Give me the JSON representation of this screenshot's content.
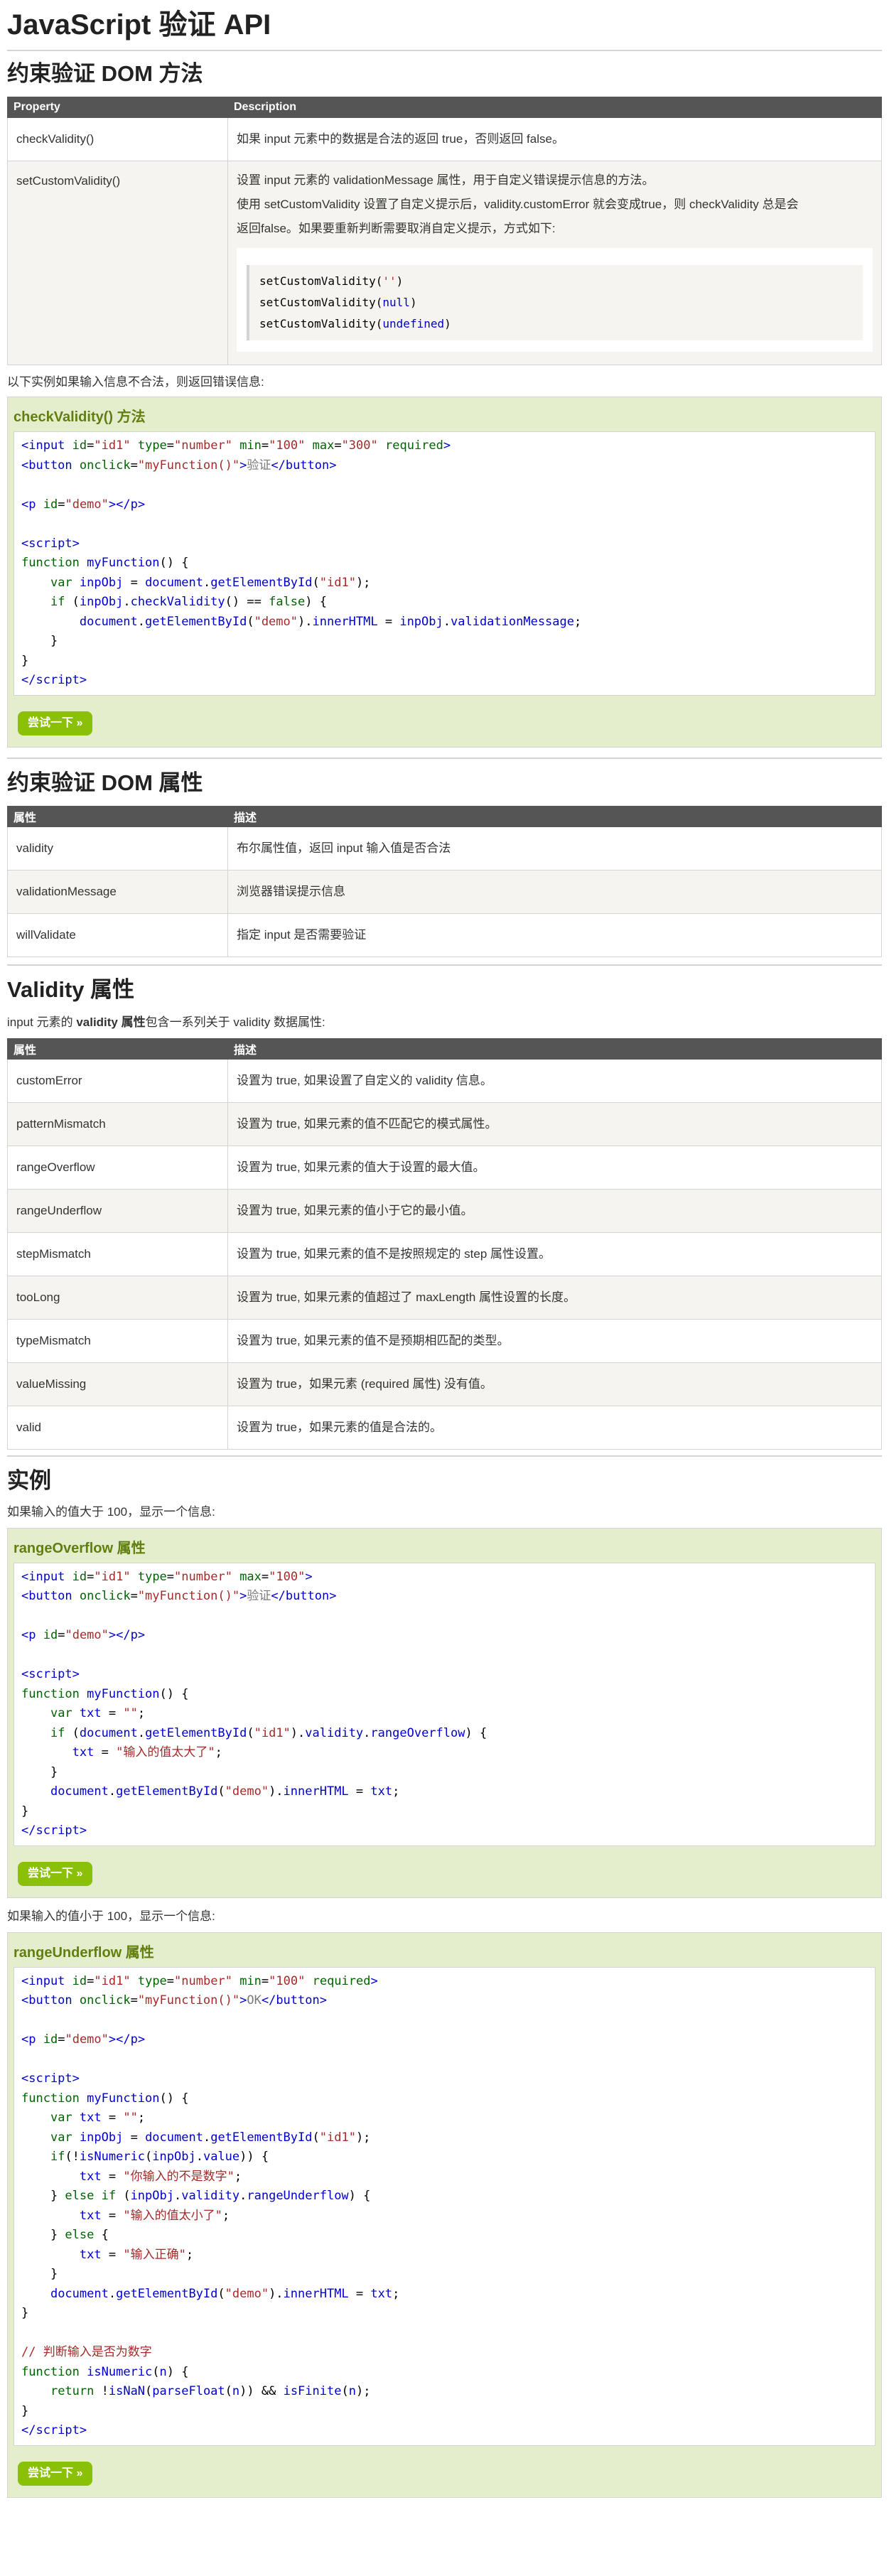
{
  "page_title": "JavaScript 验证 API",
  "section1": {
    "heading": "约束验证 DOM 方法",
    "headers": [
      "Property",
      "Description"
    ],
    "rows": [
      {
        "prop": "checkValidity()",
        "desc": "如果 input 元素中的数据是合法的返回 true，否则返回 false。"
      },
      {
        "prop": "setCustomValidity()",
        "desc_lines": [
          "设置 input 元素的 validationMessage 属性，用于自定义错误提示信息的方法。",
          "使用 setCustomValidity 设置了自定义提示后，validity.customError 就会变成true，则 checkValidity 总是会",
          "返回false。如果要重新判断需要取消自定义提示，方式如下:"
        ],
        "code_lines": [
          {
            "fn": "setCustomValidity",
            "arg": "''"
          },
          {
            "fn": "setCustomValidity",
            "arg": "null"
          },
          {
            "fn": "setCustomValidity",
            "arg": "undefined"
          }
        ]
      }
    ]
  },
  "intro1": "以下实例如果输入信息不合法，则返回错误信息:",
  "example1": {
    "title": "checkValidity() 方法",
    "try_label": "尝试一下 »"
  },
  "section2": {
    "heading": "约束验证 DOM 属性",
    "headers": [
      "属性",
      "描述"
    ],
    "rows": [
      {
        "prop": "validity",
        "desc": "布尔属性值，返回 input 输入值是否合法"
      },
      {
        "prop": "validationMessage",
        "desc": "浏览器错误提示信息"
      },
      {
        "prop": "willValidate",
        "desc": "指定 input 是否需要验证"
      }
    ]
  },
  "section3": {
    "heading": "Validity 属性",
    "intro_prefix": "input 元素的 ",
    "intro_bold": "validity 属性",
    "intro_suffix": "包含一系列关于 validity 数据属性:",
    "headers": [
      "属性",
      "描述"
    ],
    "rows": [
      {
        "prop": "customError",
        "desc": "设置为 true, 如果设置了自定义的 validity 信息。"
      },
      {
        "prop": "patternMismatch",
        "desc": "设置为 true, 如果元素的值不匹配它的模式属性。"
      },
      {
        "prop": "rangeOverflow",
        "desc": "设置为 true, 如果元素的值大于设置的最大值。"
      },
      {
        "prop": "rangeUnderflow",
        "desc": "设置为 true, 如果元素的值小于它的最小值。"
      },
      {
        "prop": "stepMismatch",
        "desc": "设置为 true, 如果元素的值不是按照规定的 step 属性设置。"
      },
      {
        "prop": "tooLong",
        "desc": "设置为 true, 如果元素的值超过了 maxLength 属性设置的长度。"
      },
      {
        "prop": "typeMismatch",
        "desc": "设置为 true, 如果元素的值不是预期相匹配的类型。"
      },
      {
        "prop": "valueMissing",
        "desc": "设置为 true，如果元素 (required 属性) 没有值。"
      },
      {
        "prop": "valid",
        "desc": "设置为 true，如果元素的值是合法的。"
      }
    ]
  },
  "section4": {
    "heading": "实例",
    "intro_a": "如果输入的值大于 100，显示一个信息:",
    "example_a": {
      "title": "rangeOverflow 属性",
      "try_label": "尝试一下 »"
    },
    "intro_b": "如果输入的值小于 100，显示一个信息:",
    "example_b": {
      "title": "rangeUnderflow 属性",
      "try_label": "尝试一下 »"
    }
  }
}
